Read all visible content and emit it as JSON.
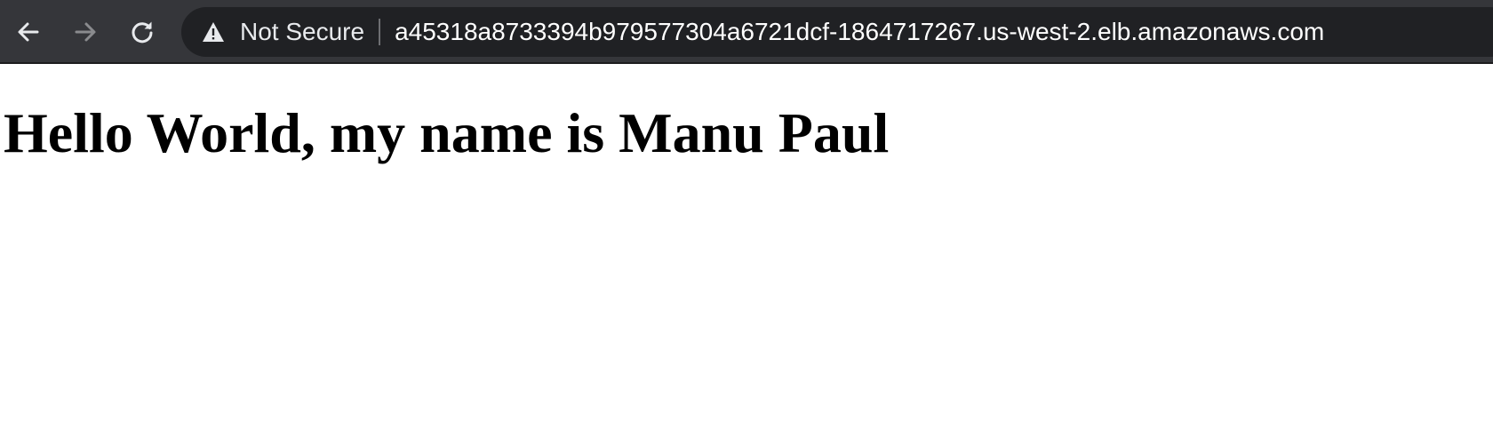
{
  "browser": {
    "nav": {
      "back_icon": "arrow-left-icon",
      "forward_icon": "arrow-right-icon",
      "reload_icon": "reload-icon"
    },
    "omnibox": {
      "security_icon": "warning-triangle-icon",
      "security_label": "Not Secure",
      "url": "a45318a8733394b979577304a6721dcf-1864717267.us-west-2.elb.amazonaws.com"
    },
    "colors": {
      "toolbar_bg": "#35363a",
      "omnibox_bg": "#202124",
      "icon_active": "#e8eaed",
      "icon_disabled": "#8a8b8e"
    }
  },
  "page": {
    "heading": "Hello World, my name is Manu Paul"
  }
}
